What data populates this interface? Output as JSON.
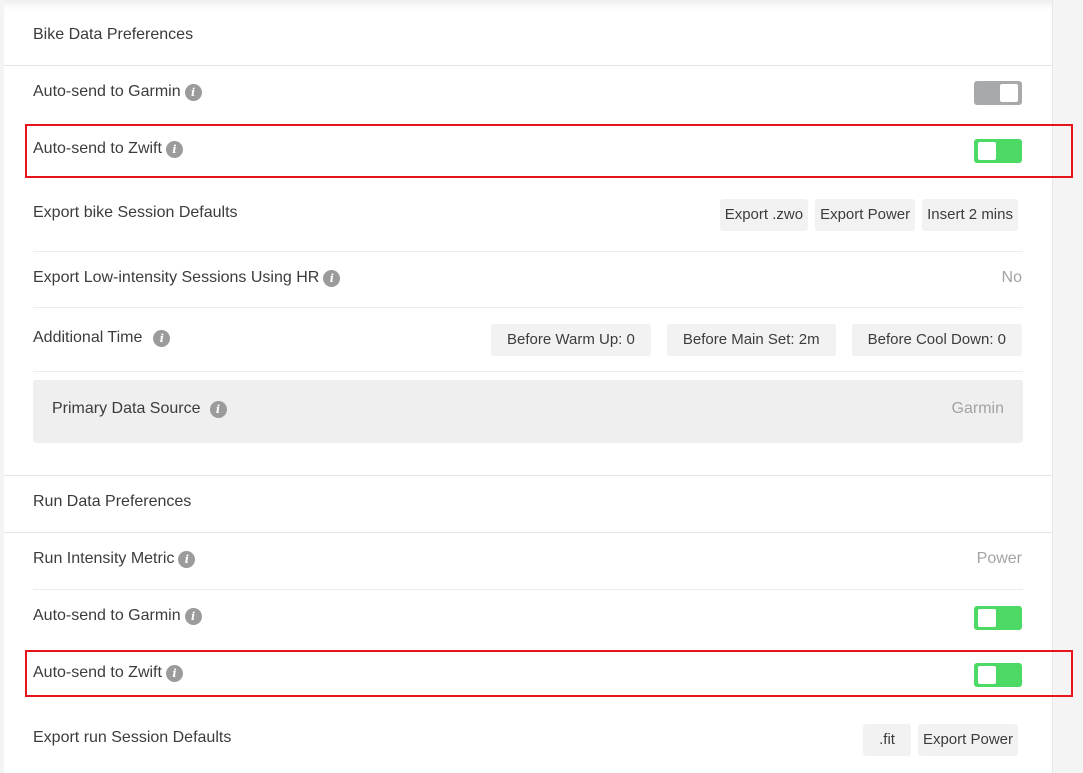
{
  "bike": {
    "title": "Bike Data Preferences",
    "auto_garmin": {
      "label": "Auto-send to Garmin",
      "enabled": false
    },
    "auto_zwift": {
      "label": "Auto-send to Zwift",
      "enabled": true
    },
    "export_defaults": {
      "label": "Export bike Session Defaults",
      "chips": [
        "Export .zwo",
        "Export Power",
        "Insert 2 mins"
      ]
    },
    "low_intensity": {
      "label": "Export Low-intensity Sessions Using HR",
      "value": "No"
    },
    "additional_time": {
      "label": "Additional Time",
      "chips": [
        "Before Warm Up: 0",
        "Before Main Set: 2m",
        "Before Cool Down: 0"
      ]
    },
    "primary_source": {
      "label": "Primary Data Source",
      "value": "Garmin"
    }
  },
  "run": {
    "title": "Run Data Preferences",
    "intensity_metric": {
      "label": "Run Intensity Metric",
      "value": "Power"
    },
    "auto_garmin": {
      "label": "Auto-send to Garmin",
      "enabled": true
    },
    "auto_zwift": {
      "label": "Auto-send to Zwift",
      "enabled": true
    },
    "export_defaults": {
      "label": "Export run Session Defaults",
      "chips": [
        ".fit",
        "Export Power"
      ]
    }
  },
  "info_glyph": "i",
  "colors": {
    "toggle_on": "#4cd964",
    "toggle_off": "#a8a9ab",
    "highlight": "#e8141b"
  }
}
